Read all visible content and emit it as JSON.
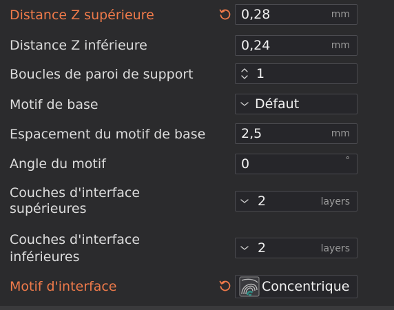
{
  "settings": {
    "top_z_distance": {
      "label": "Distance Z supérieure",
      "value": "0,28",
      "unit": "mm"
    },
    "bottom_z_distance": {
      "label": "Distance Z inférieure",
      "value": "0,24",
      "unit": "mm"
    },
    "support_wall_loops": {
      "label": "Boucles de paroi de support",
      "value": "1"
    },
    "base_pattern": {
      "label": "Motif de base",
      "value": "Défaut"
    },
    "base_pattern_spacing": {
      "label": "Espacement du motif de base",
      "value": "2,5",
      "unit": "mm"
    },
    "pattern_angle": {
      "label": "Angle du motif",
      "value": "0",
      "unit": "°"
    },
    "top_interface_layers": {
      "label_line1": "Couches d'interface",
      "label_line2": "supérieures",
      "value": "2",
      "unit": "layers"
    },
    "bottom_interface_layers": {
      "label_line1": "Couches d'interface",
      "label_line2": "inférieures",
      "value": "2",
      "unit": "layers"
    },
    "interface_pattern": {
      "label": "Motif d'interface",
      "value": "Concentrique"
    }
  },
  "colors": {
    "modified_label": "#ef7a4a",
    "label": "#dcdcdc",
    "field_bg": "#26262a",
    "field_border": "#4b4b50",
    "pattern_icon_teal": "#2f8f86"
  }
}
